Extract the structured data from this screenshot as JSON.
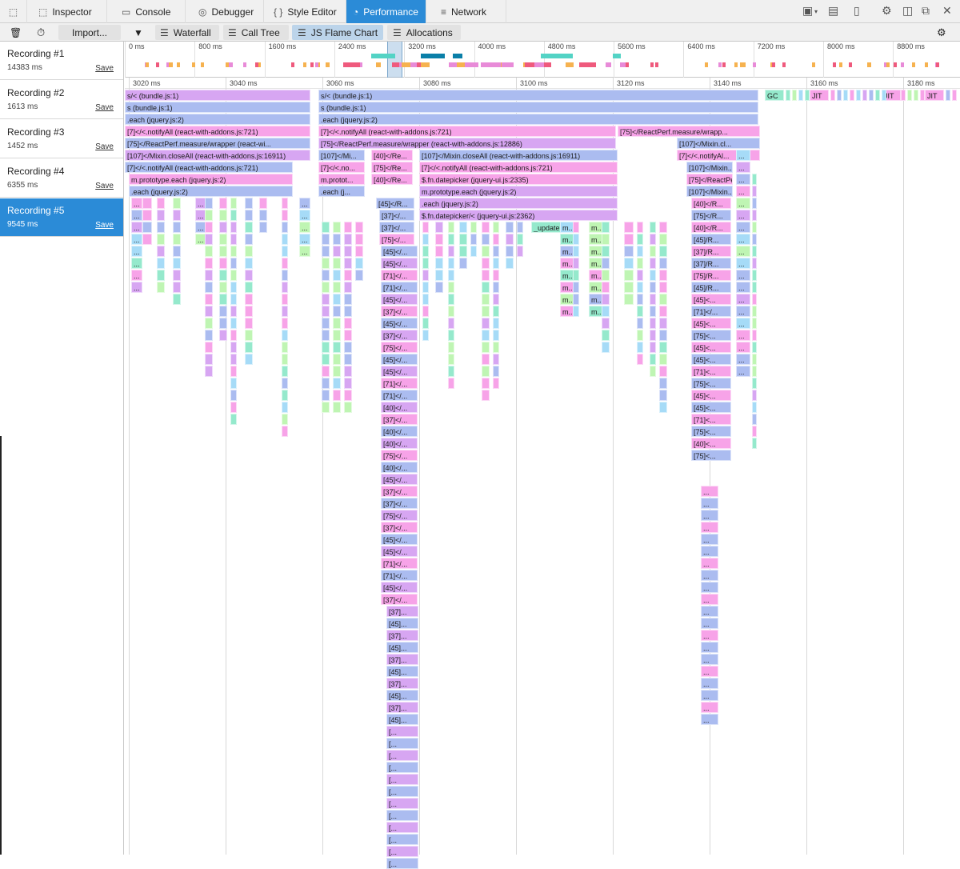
{
  "tabs": [
    {
      "name": "pick",
      "label": "",
      "icon": "element-picker-icon"
    },
    {
      "name": "inspector",
      "label": "Inspector",
      "icon": "inspector-icon"
    },
    {
      "name": "console",
      "label": "Console",
      "icon": "console-icon"
    },
    {
      "name": "debugger",
      "label": "Debugger",
      "icon": "debugger-icon"
    },
    {
      "name": "style-editor",
      "label": "Style Editor",
      "icon": "braces-icon"
    },
    {
      "name": "performance",
      "label": "Performance",
      "icon": "gauge-icon",
      "active": true
    },
    {
      "name": "network",
      "label": "Network",
      "icon": "network-icon"
    }
  ],
  "toolbar": {
    "import_label": "Import...",
    "waterfall_label": "Waterfall",
    "calltree_label": "Call Tree",
    "flamechart_label": "JS Flame Chart",
    "allocations_label": "Allocations"
  },
  "recordings": [
    {
      "name": "Recording #1",
      "duration": "14383 ms",
      "save": "Save"
    },
    {
      "name": "Recording #2",
      "duration": "1613 ms",
      "save": "Save"
    },
    {
      "name": "Recording #3",
      "duration": "1452 ms",
      "save": "Save"
    },
    {
      "name": "Recording #4",
      "duration": "6355 ms",
      "save": "Save"
    },
    {
      "name": "Recording #5",
      "duration": "9545 ms",
      "save": "Save",
      "selected": true
    }
  ],
  "overview_ticks": [
    "0 ms",
    "800 ms",
    "1600 ms",
    "2400 ms",
    "3200 ms",
    "4000 ms",
    "4800 ms",
    "5600 ms",
    "6400 ms",
    "7200 ms",
    "8000 ms",
    "8800 ms"
  ],
  "flame_ticks": [
    "3020 ms",
    "3040 ms",
    "3060 ms",
    "3080 ms",
    "3100 ms",
    "3120 ms",
    "3140 ms",
    "3160 ms",
    "3180 ms"
  ],
  "colors": {
    "purple": "#d7a6f2",
    "blue": "#abbcf0",
    "pink": "#f7a3e8",
    "cyan": "#a6dbf7",
    "green": "#bff5b3",
    "teal": "#95e9cc",
    "accent": "#2b8bd7"
  },
  "frames": [
    {
      "label": "s/< (bundle.js:1)"
    },
    {
      "label": "s (bundle.js:1)"
    },
    {
      "label": ".each (jquery.js:2)"
    },
    {
      "label": "[7]</<.notifyAll (react-with-addons.js:721)"
    },
    {
      "label": "[75]</ReactPerf.measure/wrapper (react-wi..."
    },
    {
      "label": "[107]</Mixin.closeAll (react-with-addons.js:16911)"
    },
    {
      "label": "[7]</<.notifyAll (react-with-addons.js:721)"
    },
    {
      "label": "m.prototype.each (jquery.js:2)"
    },
    {
      "label": ".each (jquery.js:2)"
    },
    {
      "label": "s/< (bundle.js:1)"
    },
    {
      "label": "s (bundle.js:1)"
    },
    {
      "label": ".each (jquery.js:2)"
    },
    {
      "label": "[7]</<.notifyAll (react-with-addons.js:721)"
    },
    {
      "label": "[75]</ReactPerf.measure/wrapper (react-with-addons.js:12886)"
    },
    {
      "label": "[107]</Mi..."
    },
    {
      "label": "[7]</<.no..."
    },
    {
      "label": "m.protot..."
    },
    {
      "label": ".each (j..."
    },
    {
      "label": "[40]</Re..."
    },
    {
      "label": "[75]</Re..."
    },
    {
      "label": "[40]</Re..."
    },
    {
      "label": "[107]</Mixin.closeAll (react-with-addons.js:16911)"
    },
    {
      "label": "[7]</<.notifyAll (react-with-addons.js:721)"
    },
    {
      "label": "$.fn.datepicker (jquery-ui.js:2335)"
    },
    {
      "label": "m.prototype.each (jquery.js:2)"
    },
    {
      "label": ".each (jquery.js:2)"
    },
    {
      "label": "$.fn.datepicker/< (jquery-ui.js:2362)"
    },
    {
      "label": "[45]</R..."
    },
    {
      "label": "[37]</..."
    },
    {
      "label": "[37]</..."
    },
    {
      "label": "[75]</..."
    },
    {
      "label": "_updateD..."
    },
    {
      "label": "[75]</ReactPerf.measure/wrapp..."
    },
    {
      "label": "[107]</Mixin.cl..."
    },
    {
      "label": "[7]</<.notifyAl..."
    },
    {
      "label": "[107]</Mixin..."
    },
    {
      "label": "[75]</ReactPe..."
    },
    {
      "label": "[107]</Mixin..."
    },
    {
      "label": "GC"
    },
    {
      "label": "JIT"
    },
    {
      "label": "JIT"
    },
    {
      "label": "JIT"
    }
  ],
  "deep_labels": [
    "[45]</...",
    "[45]</...",
    "[71]</...",
    "[71]</...",
    "[45]</...",
    "[37]</...",
    "[45]</...",
    "[37]</...",
    "[75]</...",
    "[45]</...",
    "[45]</...",
    "[71]</...",
    "[71]</...",
    "[40]</...",
    "[37]</...",
    "[40]</...",
    "[40]</...",
    "[75]</...",
    "[40]</...",
    "[45]</...",
    "[37]</...",
    "[37]</...",
    "[75]</...",
    "[37]</...",
    "[45]</...",
    "[45]</...",
    "[71]</...",
    "[71]</...",
    "[45]</...",
    "[37]</..."
  ],
  "right_deep_labels": [
    "[40]</R...",
    "[75]</R...",
    "[40]</R...",
    "[45]/R...",
    "[37]/R...",
    "[37]/R...",
    "[75]/R...",
    "[45]/R...",
    "[45]<...",
    "[71]</...",
    "[45]<...",
    "[75]<...",
    "[45]<...",
    "[45]<...",
    "[71]<...",
    "[75]<...",
    "[45]<...",
    "[45]<...",
    "[71]<...",
    "[75]<...",
    "[40]<...",
    "[75]<..."
  ]
}
